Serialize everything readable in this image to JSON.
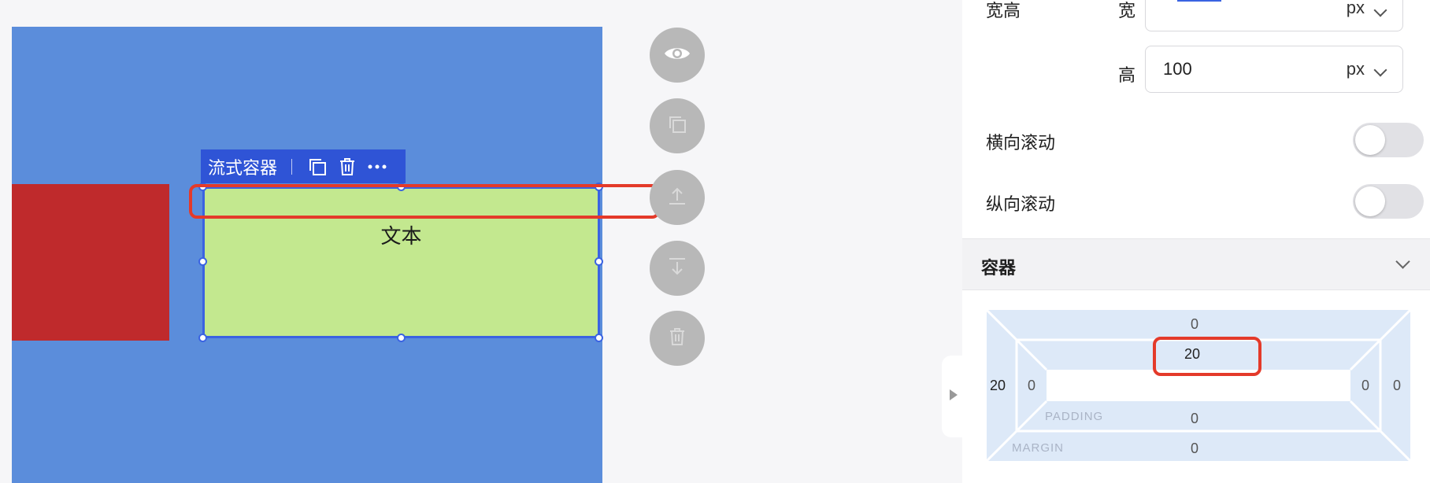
{
  "selection_toolbar": {
    "label": "流式容器",
    "icons": [
      "copy-icon",
      "trash-icon",
      "more-icon"
    ]
  },
  "canvas": {
    "background": "#5b8ddb",
    "red_color": "#bf2a2c",
    "green_color": "#c3e88f",
    "green_text": "文本"
  },
  "side_actions": [
    "eye-icon",
    "copy-icon",
    "move-up-icon",
    "move-down-icon",
    "trash-icon"
  ],
  "panel": {
    "size_label": "宽高",
    "width_label": "宽",
    "width_unit": "px",
    "height_label": "高",
    "height_value": "100",
    "height_unit": "px",
    "h_scroll_label": "横向滚动",
    "v_scroll_label": "纵向滚动",
    "h_scroll_on": false,
    "v_scroll_on": false,
    "container_section": "容器"
  },
  "box_model": {
    "margin_label": "MARGIN",
    "padding_label": "PADDING",
    "margin_top": "0",
    "margin_left": "20",
    "margin_right": "0",
    "margin_bottom": "0",
    "padding_top": "20",
    "padding_left": "0",
    "padding_right": "0",
    "padding_bottom": "0"
  },
  "colors": {
    "accent": "#2f54d6",
    "highlight": "#e43a2a"
  }
}
